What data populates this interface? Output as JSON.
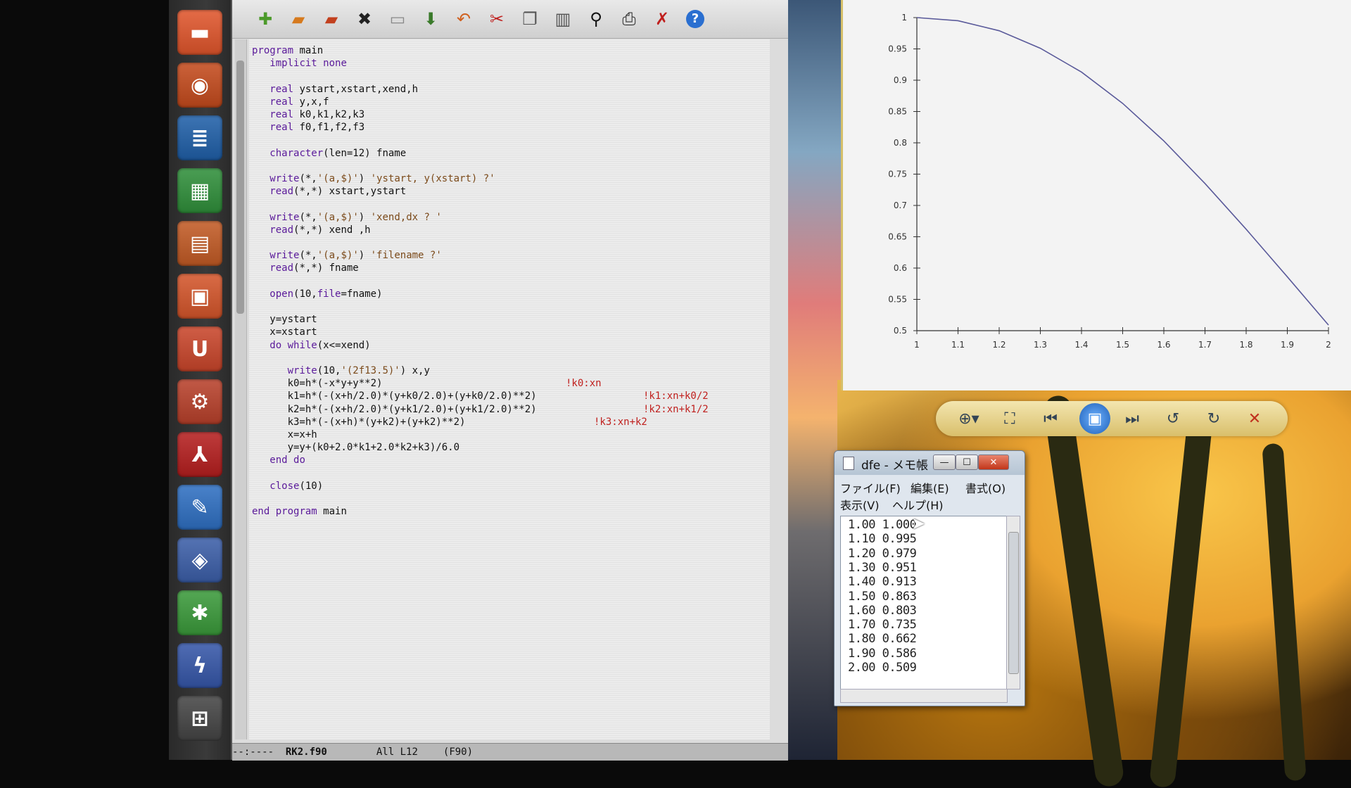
{
  "launcher": {
    "items": [
      {
        "icon": "folder-icon",
        "glyph": "▬",
        "color": "#e0552b"
      },
      {
        "icon": "firefox-icon",
        "glyph": "◉",
        "color": "#c44a1c"
      },
      {
        "icon": "writer-icon",
        "glyph": "≣",
        "color": "#1f5fa8"
      },
      {
        "icon": "calc-icon",
        "glyph": "▦",
        "color": "#2f8f3a"
      },
      {
        "icon": "impress-icon",
        "glyph": "▤",
        "color": "#c25a24"
      },
      {
        "icon": "software-center-icon",
        "glyph": "▣",
        "color": "#d4552a"
      },
      {
        "icon": "ubuntu-one-icon",
        "glyph": "U",
        "color": "#c9452a"
      },
      {
        "icon": "system-settings-icon",
        "glyph": "⚙",
        "color": "#b8402a"
      },
      {
        "icon": "adobe-reader-icon",
        "glyph": "⅄",
        "color": "#b51e1e"
      },
      {
        "icon": "text-editor-icon",
        "glyph": "✎",
        "color": "#2e6fc2"
      },
      {
        "icon": "php-icon",
        "glyph": "◈",
        "color": "#3b5ea8"
      },
      {
        "icon": "gnuplot-icon",
        "glyph": "✱",
        "color": "#3a9a3a"
      },
      {
        "icon": "emacs-icon",
        "glyph": "ϟ",
        "color": "#3556a8"
      },
      {
        "icon": "workspace-switcher-icon",
        "glyph": "⊞",
        "color": "#444444"
      }
    ]
  },
  "toolbar": {
    "buttons": [
      {
        "name": "new-file-button",
        "icon": "new-file-icon",
        "glyph": "✚",
        "color": "#4c9a2a"
      },
      {
        "name": "open-file-button",
        "icon": "folder-open-icon",
        "glyph": "▰",
        "color": "#d67a1e"
      },
      {
        "name": "open-directory-button",
        "icon": "folder-icon",
        "glyph": "▰",
        "color": "#c2401e"
      },
      {
        "name": "close-buffer-button",
        "icon": "close-icon",
        "glyph": "✖",
        "color": "#222222"
      },
      {
        "name": "save-button",
        "icon": "save-icon",
        "glyph": "▭",
        "color": "#888888"
      },
      {
        "name": "save-as-button",
        "icon": "save-as-icon",
        "glyph": "⬇",
        "color": "#3a7a2a"
      },
      {
        "name": "undo-button",
        "icon": "undo-icon",
        "glyph": "↶",
        "color": "#d0601e"
      },
      {
        "name": "cut-button",
        "icon": "scissors-icon",
        "glyph": "✂",
        "color": "#c0201e"
      },
      {
        "name": "copy-button",
        "icon": "copy-icon",
        "glyph": "❐",
        "color": "#555555"
      },
      {
        "name": "paste-button",
        "icon": "paste-icon",
        "glyph": "▥",
        "color": "#555555"
      },
      {
        "name": "search-button",
        "icon": "search-icon",
        "glyph": "⚲",
        "color": "#111111"
      },
      {
        "name": "print-button",
        "icon": "printer-icon",
        "glyph": "⎙",
        "color": "#222222"
      },
      {
        "name": "preferences-button",
        "icon": "tools-icon",
        "glyph": "✗",
        "color": "#c0201e"
      },
      {
        "name": "help-button",
        "icon": "help-icon",
        "glyph": "?",
        "color": "#2a6fd0"
      }
    ]
  },
  "code": {
    "lines": [
      "program main",
      "   implicit none",
      "",
      "   real ystart,xstart,xend,h",
      "   real y,x,f",
      "   real k0,k1,k2,k3",
      "   real f0,f1,f2,f3",
      "",
      "   character(len=12) fname",
      "",
      "   write(*,'(a,$)') 'ystart, y(xstart) ?'",
      "   read(*,*) xstart,ystart",
      "",
      "   write(*,'(a,$)') 'xend,dx ? '",
      "   read(*,*) xend ,h",
      "",
      "   write(*,'(a,$)') 'filename ?'",
      "   read(*,*) fname",
      "",
      "   open(10,file=fname)",
      "",
      "   y=ystart",
      "   x=xstart",
      "   do while(x<=xend)",
      "",
      "      write(10,'(2f13.5)') x,y",
      "      k0=h*(-x*y+y**2)",
      "      k1=h*(-(x+h/2.0)*(y+k0/2.0)+(y+k0/2.0)**2)",
      "      k2=h*(-(x+h/2.0)*(y+k1/2.0)+(y+k1/2.0)**2)",
      "      k3=h*(-(x+h)*(y+k2)+(y+k2)**2)",
      "      x=x+h",
      "      y=y+(k0+2.0*k1+2.0*k2+k3)/6.0",
      "   end do",
      "",
      "   close(10)",
      "",
      "end program main"
    ],
    "comments": [
      {
        "line": 26,
        "text": "!k0:xn"
      },
      {
        "line": 27,
        "text": "!k1:xn+k0/2"
      },
      {
        "line": 28,
        "text": "!k2:xn+k1/2"
      },
      {
        "line": 29,
        "text": "!k3:xn+k2"
      }
    ]
  },
  "modeline": {
    "status": "--:----  ",
    "buffer": "RK2.f90",
    "position": "All L12",
    "mode": "(F90)"
  },
  "chart_data": {
    "type": "line",
    "x": [
      1.0,
      1.1,
      1.2,
      1.3,
      1.4,
      1.5,
      1.6,
      1.7,
      1.8,
      1.9,
      2.0
    ],
    "series": [
      {
        "values": [
          1.0,
          0.995,
          0.979,
          0.951,
          0.913,
          0.863,
          0.803,
          0.735,
          0.662,
          0.586,
          0.509
        ]
      }
    ],
    "xlim": [
      1,
      2
    ],
    "ylim": [
      0.5,
      1
    ],
    "xticks": [
      "1",
      "1.1",
      "1.2",
      "1.3",
      "1.4",
      "1.5",
      "1.6",
      "1.7",
      "1.8",
      "1.9",
      "2"
    ],
    "yticks": [
      "0.5",
      "0.55",
      "0.6",
      "0.65",
      "0.7",
      "0.75",
      "0.8",
      "0.85",
      "0.9",
      "0.95",
      "1"
    ],
    "color": "#5a5a9a",
    "grid": false,
    "title": "",
    "xlabel": "",
    "ylabel": ""
  },
  "viewer": {
    "buttons": [
      {
        "name": "zoom-button",
        "icon": "zoom-icon",
        "glyph": "⊕▾"
      },
      {
        "name": "actual-size-button",
        "icon": "fit-window-icon",
        "glyph": "⛶"
      },
      {
        "name": "previous-button",
        "icon": "previous-icon",
        "glyph": "⏮"
      },
      {
        "name": "slideshow-button",
        "icon": "slideshow-icon",
        "glyph": "▣"
      },
      {
        "name": "next-button",
        "icon": "next-icon",
        "glyph": "⏭"
      },
      {
        "name": "rotate-left-button",
        "icon": "rotate-ccw-icon",
        "glyph": "↺"
      },
      {
        "name": "rotate-right-button",
        "icon": "rotate-cw-icon",
        "glyph": "↻"
      },
      {
        "name": "delete-button",
        "icon": "delete-icon",
        "glyph": "✕"
      }
    ]
  },
  "notepad": {
    "title": "dfe - メモ帳",
    "menus": [
      "ファイル(F)",
      "編集(E)",
      "書式(O)",
      "表示(V)",
      "ヘルプ(H)"
    ],
    "lines": [
      "1.00 1.000",
      "1.10 0.995",
      "1.20 0.979",
      "1.30 0.951",
      "1.40 0.913",
      "1.50 0.863",
      "1.60 0.803",
      "1.70 0.735",
      "1.80 0.662",
      "1.90 0.586",
      "2.00 0.509"
    ],
    "minimize": "—",
    "maximize": "☐",
    "close": "✕"
  }
}
